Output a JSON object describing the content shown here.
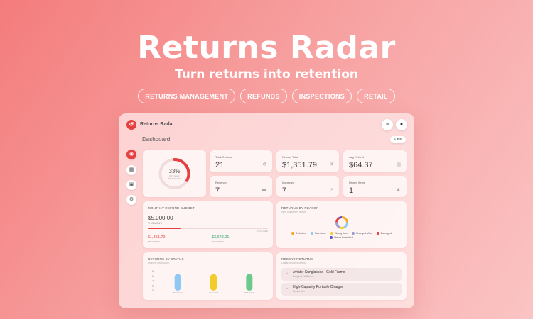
{
  "hero": {
    "title": "Returns Radar",
    "subtitle": "Turn returns into retention",
    "tags": [
      "RETURNS MANAGEMENT",
      "REFUNDS",
      "INSPECTIONS",
      "RETAIL"
    ]
  },
  "app": {
    "brand": "Returns Radar",
    "page_title": "Dashboard",
    "edit_label": "Edit",
    "header_icons": [
      "menu-icon",
      "user-icon"
    ],
    "sidebar": [
      {
        "icon": "dashboard-icon",
        "glyph": "◉",
        "active": true
      },
      {
        "icon": "calendar-icon",
        "glyph": "▦",
        "active": false
      },
      {
        "icon": "box-icon",
        "glyph": "▣",
        "active": false
      },
      {
        "icon": "settings-icon",
        "glyph": "⚙",
        "active": false
      }
    ],
    "returning": {
      "percent": 33,
      "percent_label": "33%",
      "label_line1": "RETURNS",
      "label_line2": "RETURNED"
    },
    "stats": [
      {
        "label": "Total Returns",
        "value": "21",
        "icon": "undo-icon",
        "glyph": "↺"
      },
      {
        "label": "Refund Total",
        "value": "$1,351.79",
        "icon": "dollar-icon",
        "glyph": "$"
      },
      {
        "label": "Avg Refund",
        "value": "$64.37",
        "icon": "receipt-icon",
        "glyph": "▤"
      },
      {
        "label": "Received",
        "value": "7",
        "icon": "inbox-icon",
        "glyph": "▬"
      },
      {
        "label": "Inspected",
        "value": "7",
        "icon": "search-icon",
        "glyph": "⌕"
      },
      {
        "label": "Urgent Items",
        "value": "1",
        "icon": "warning-icon",
        "glyph": "▲"
      }
    ],
    "budget": {
      "title": "MONTHLY REFUND BUDGET",
      "amount": "$5,000.00",
      "period": "THIS MONTH",
      "used_fraction": 0.27,
      "used_label": "27% USED",
      "refunded_value": "$1,351.79",
      "refunded_label": "REFUNDED",
      "remaining_value": "$3,648.21",
      "remaining_label": "REMAINING",
      "accent": "#e53f3f",
      "remaining_color": "#35a56b"
    },
    "reasons": {
      "title": "RETURNS BY REASON",
      "subtitle": "Why customers return",
      "items": [
        {
          "name": "Defective",
          "color": "#f5a623",
          "value": 5
        },
        {
          "name": "Size Issue",
          "color": "#8fc8f2",
          "value": 4
        },
        {
          "name": "Wrong Item",
          "color": "#f2cc2a",
          "value": 3
        },
        {
          "name": "Changed Mind",
          "color": "#9b9bd6",
          "value": 4
        },
        {
          "name": "Damaged",
          "color": "#e53f3f",
          "value": 3
        },
        {
          "name": "Not as Described",
          "color": "#5a4fc8",
          "value": 2
        }
      ]
    },
    "status_chart": {
      "title": "RETURNS BY STATUS",
      "subtitle": "Pipeline distribution",
      "y_ticks": [
        "8",
        "6",
        "4",
        "2",
        "0"
      ],
      "y_max": 8,
      "bars": [
        {
          "label": "Received",
          "value": 7,
          "color": "#8fc8f2"
        },
        {
          "label": "Inspected",
          "value": 7,
          "color": "#f2cc2a"
        },
        {
          "label": "Refunded",
          "value": 7,
          "color": "#6cc98c"
        }
      ]
    },
    "recent": {
      "title": "RECENT RETURNS",
      "subtitle": "Latest incoming items",
      "items": [
        {
          "name": "Aviator Sunglasses - Gold Frame",
          "customer": "Benjamin Williams"
        },
        {
          "name": "High-Capacity Portable Charger",
          "customer": "Daniel Kim"
        }
      ]
    }
  }
}
